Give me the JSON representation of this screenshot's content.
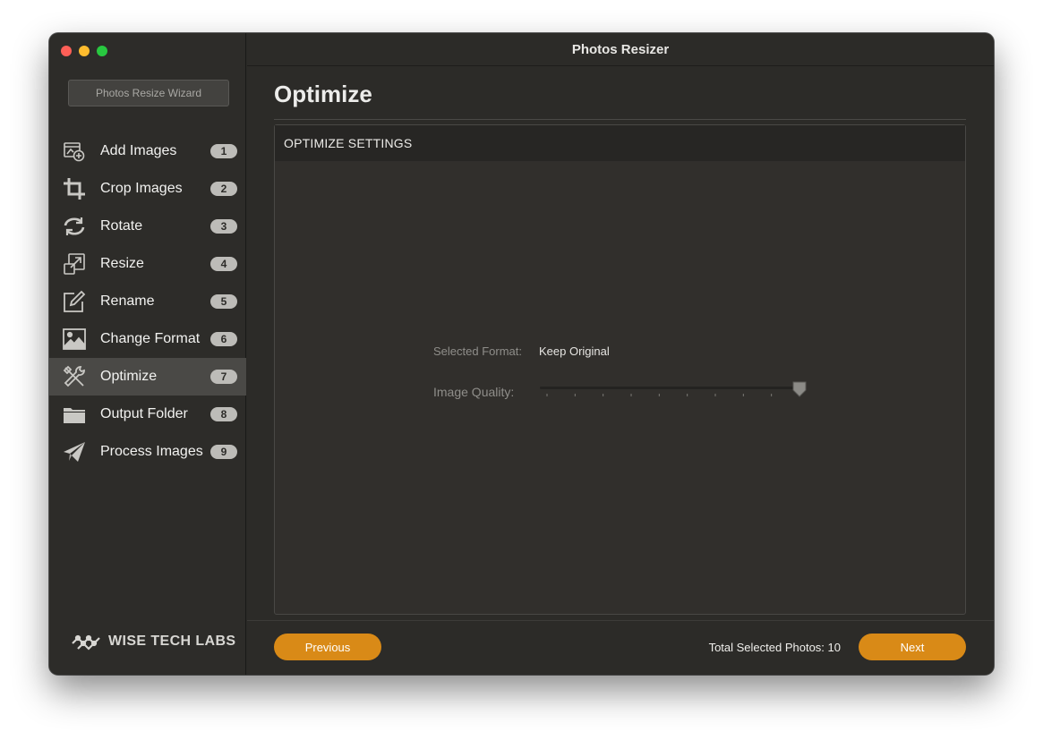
{
  "window": {
    "title": "Photos Resizer"
  },
  "sidebar": {
    "wizard_button": "Photos Resize Wizard",
    "items": [
      {
        "label": "Add Images",
        "badge": "1",
        "icon": "add-images-icon"
      },
      {
        "label": "Crop Images",
        "badge": "2",
        "icon": "crop-icon"
      },
      {
        "label": "Rotate",
        "badge": "3",
        "icon": "rotate-icon"
      },
      {
        "label": "Resize",
        "badge": "4",
        "icon": "resize-icon"
      },
      {
        "label": "Rename",
        "badge": "5",
        "icon": "rename-icon"
      },
      {
        "label": "Change Format",
        "badge": "6",
        "icon": "image-icon"
      },
      {
        "label": "Optimize",
        "badge": "7",
        "icon": "tools-icon",
        "active": true
      },
      {
        "label": "Output Folder",
        "badge": "8",
        "icon": "folder-icon"
      },
      {
        "label": "Process Images",
        "badge": "9",
        "icon": "paper-plane-icon"
      }
    ],
    "brand": "WISE TECH LABS"
  },
  "main": {
    "page_title": "Optimize",
    "panel": {
      "header": "OPTIMIZE SETTINGS",
      "selected_format_label": "Selected Format:",
      "selected_format_value": "Keep Original",
      "image_quality_label": "Image Quality:",
      "image_quality_fraction": 1.0,
      "tick_count": 10
    },
    "footer": {
      "previous_label": "Previous",
      "next_label": "Next",
      "total_label": "Total Selected Photos: 10"
    }
  },
  "colors": {
    "accent": "#d98a17",
    "background": "#2b2a27",
    "active_item": "#4a4946"
  }
}
